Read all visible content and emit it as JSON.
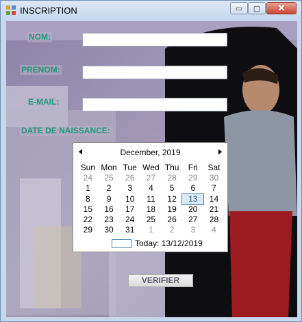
{
  "window": {
    "title": "INSCRIPTION",
    "controls": {
      "minimize": "▭",
      "maximize": "▢",
      "close": "✕"
    }
  },
  "form": {
    "nom_label": "NOM:",
    "prenom_label": "PRENOM:",
    "email_label": "E-MAIL:",
    "dob_label": "DATE DE NAISSANCE:",
    "nom_value": "",
    "prenom_value": "",
    "email_value": "",
    "label_color": "#1f9a7a"
  },
  "calendar": {
    "month_label": "December, 2019",
    "weekdays": [
      "Sun",
      "Mon",
      "Tue",
      "Wed",
      "Thu",
      "Fri",
      "Sat"
    ],
    "weeks": [
      [
        "24",
        "25",
        "26",
        "27",
        "28",
        "29",
        "30"
      ],
      [
        "1",
        "2",
        "3",
        "4",
        "5",
        "6",
        "7"
      ],
      [
        "8",
        "9",
        "10",
        "11",
        "12",
        "13",
        "14"
      ],
      [
        "15",
        "16",
        "17",
        "18",
        "19",
        "20",
        "21"
      ],
      [
        "22",
        "23",
        "24",
        "25",
        "26",
        "27",
        "28"
      ],
      [
        "29",
        "30",
        "31",
        "1",
        "2",
        "3",
        "4"
      ]
    ],
    "muted_first_row": true,
    "muted_last_row_from": 3,
    "selected": "13",
    "today_text": "Today: 13/12/2019"
  },
  "actions": {
    "verify_label": "VERIFIER"
  }
}
